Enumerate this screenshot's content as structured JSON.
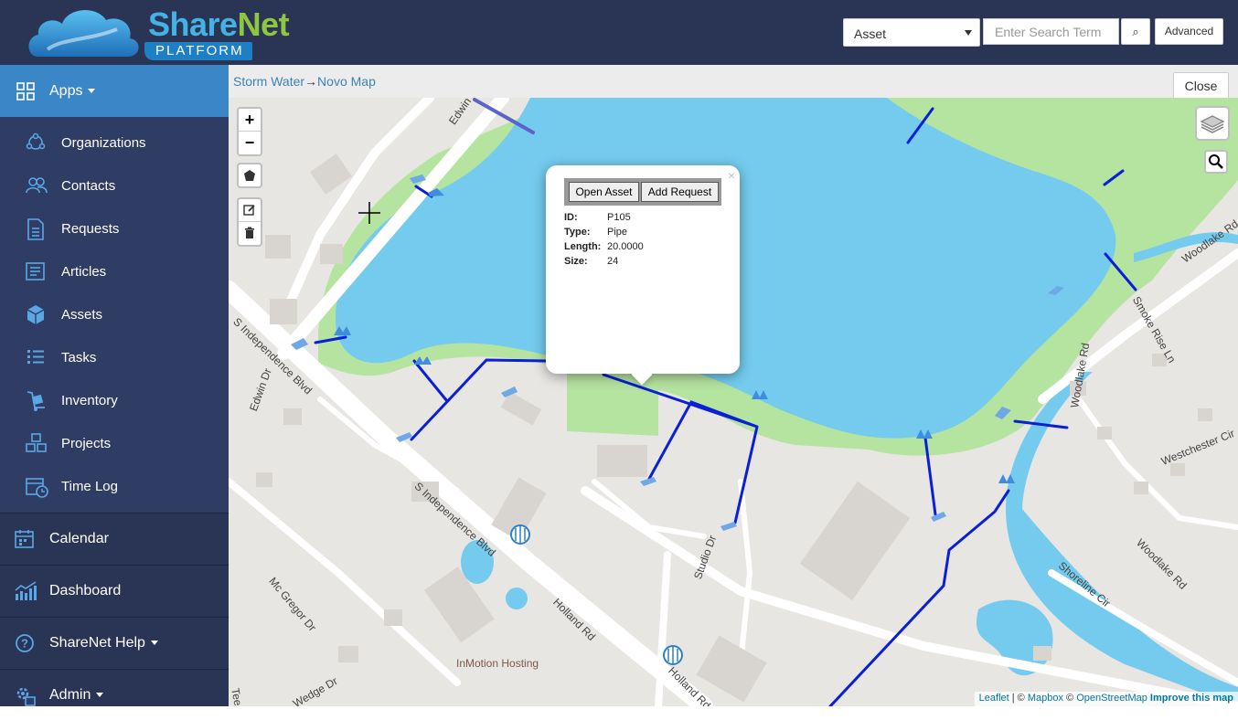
{
  "header": {
    "logo_main_a": "Share",
    "logo_main_b": "Net",
    "logo_sub": "PLATFORM",
    "search_type": "Asset",
    "search_placeholder": "Enter Search Term",
    "search_button": "⌕",
    "advanced_label": "Advanced"
  },
  "sidebar": {
    "apps_label": "Apps",
    "submenu": [
      {
        "label": "Organizations",
        "icon": "organizations-icon"
      },
      {
        "label": "Contacts",
        "icon": "contacts-icon"
      },
      {
        "label": "Requests",
        "icon": "requests-icon"
      },
      {
        "label": "Articles",
        "icon": "articles-icon"
      },
      {
        "label": "Assets",
        "icon": "assets-icon"
      },
      {
        "label": "Tasks",
        "icon": "tasks-icon"
      },
      {
        "label": "Inventory",
        "icon": "inventory-icon"
      },
      {
        "label": "Projects",
        "icon": "projects-icon"
      },
      {
        "label": "Time Log",
        "icon": "time-log-icon"
      }
    ],
    "main": [
      {
        "label": "Calendar",
        "icon": "calendar-icon"
      },
      {
        "label": "Dashboard",
        "icon": "dashboard-icon"
      },
      {
        "label": "ShareNet Help",
        "icon": "help-icon"
      },
      {
        "label": "Admin",
        "icon": "admin-icon"
      }
    ],
    "accent_color": "#3b86c7"
  },
  "breadcrumb": {
    "part1": "Storm Water",
    "separator": "→",
    "part2": "Novo Map"
  },
  "close_label": "Close",
  "map": {
    "zoom_in": "+",
    "zoom_out": "−",
    "popup": {
      "open_asset": "Open Asset",
      "add_request": "Add Request",
      "close": "×",
      "fields": [
        {
          "key": "ID:",
          "value": "P105"
        },
        {
          "key": "Type:",
          "value": "Pipe"
        },
        {
          "key": "Length:",
          "value": "20.0000"
        },
        {
          "key": "Size:",
          "value": "24"
        }
      ]
    },
    "labels": {
      "edwin": "Edwin",
      "edwin_dr": "Edwin Dr",
      "s_independence_1": "S Independence Blvd",
      "s_independence_2": "S Independence Blvd",
      "holland_1": "Holland Rd",
      "holland_2": "Holland Rd",
      "mc_gregor": "Mc Gregor Dr",
      "wedge": "Wedge Dr",
      "tee": "Tee",
      "studio": "Studio Dr",
      "woodlake_rd": "Woodlake Rd",
      "woodlake_top": "Woodlake Rd",
      "woodlake_right": "Woodlake Rd",
      "smoke_rise": "Smoke Rise Ln",
      "westchester": "Westchester Cir",
      "shoreline": "Shoreline Cir",
      "inmotion": "InMotion Hosting"
    },
    "attribution": {
      "leaflet": "Leaflet",
      "sep": " | © ",
      "mapbox": "Mapbox",
      "sep2": " © ",
      "osm": "OpenStreetMap",
      "improve": " Improve this map"
    },
    "pipe_color": "#0a1fd6",
    "water_color": "#74cbee",
    "park_color": "#b5e3a0"
  }
}
